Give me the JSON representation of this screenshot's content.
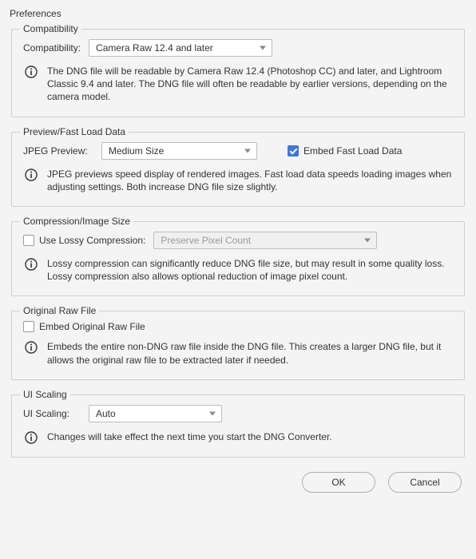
{
  "title": "Preferences",
  "compatibility": {
    "group_title": "Compatibility",
    "label": "Compatibility:",
    "value": "Camera Raw 12.4 and later",
    "info": "The DNG file will be readable by Camera Raw 12.4 (Photoshop CC) and later, and Lightroom Classic 9.4 and later. The DNG file will often be readable by earlier versions, depending on the camera model."
  },
  "preview": {
    "group_title": "Preview/Fast Load Data",
    "label": "JPEG Preview:",
    "value": "Medium Size",
    "embed_label": "Embed Fast Load Data",
    "info": "JPEG previews speed display of rendered images.  Fast load data speeds loading images when adjusting settings.  Both increase DNG file size slightly."
  },
  "compression": {
    "group_title": "Compression/Image Size",
    "checkbox_label": "Use Lossy Compression:",
    "select_value": "Preserve Pixel Count",
    "info": "Lossy compression can significantly reduce DNG file size, but may result in some quality loss.  Lossy compression also allows optional reduction of image pixel count."
  },
  "original": {
    "group_title": "Original Raw File",
    "checkbox_label": "Embed Original Raw File",
    "info": "Embeds the entire non-DNG raw file inside the DNG file.  This creates a larger DNG file, but it allows the original raw file to be extracted later if needed."
  },
  "ui_scaling": {
    "group_title": "UI Scaling",
    "label": "UI Scaling:",
    "value": "Auto",
    "info": "Changes will take effect the next time you start the DNG Converter."
  },
  "buttons": {
    "ok": "OK",
    "cancel": "Cancel"
  }
}
